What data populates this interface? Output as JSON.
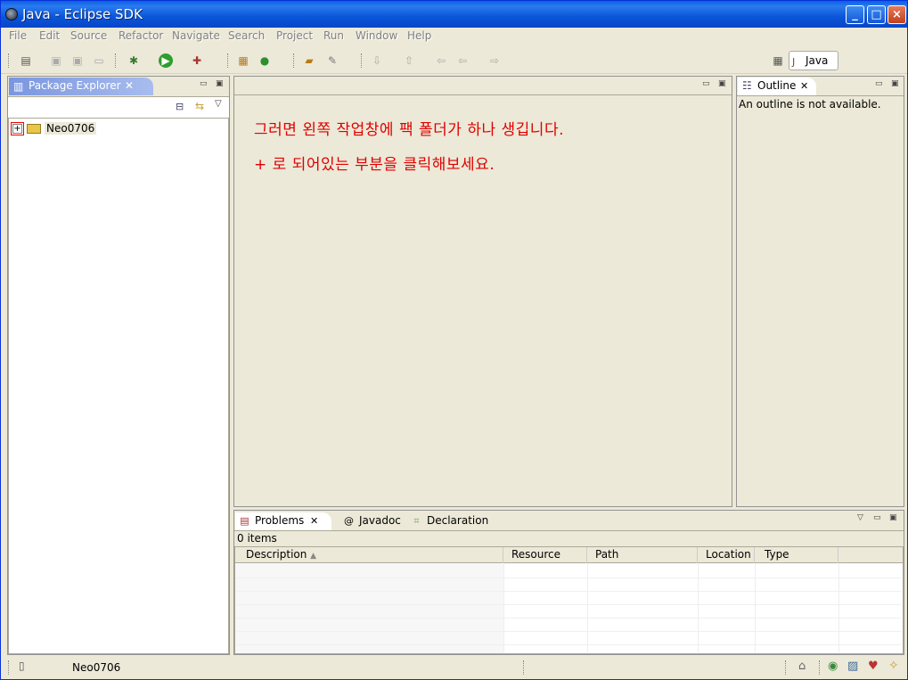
{
  "window": {
    "title": "Java - Eclipse SDK",
    "minimize": "_",
    "maximize": "□",
    "close": "×"
  },
  "menu": [
    "File",
    "Edit",
    "Source",
    "Refactor",
    "Navigate",
    "Search",
    "Project",
    "Run",
    "Window",
    "Help"
  ],
  "perspective": {
    "label": "Java"
  },
  "package_explorer": {
    "tab_label": "Package Explorer",
    "tree": [
      {
        "label": "Neo0706",
        "expander": "+"
      }
    ]
  },
  "editor": {
    "line1": "그러면 왼쪽 작업창에 팩 폴더가 하나 생깁니다.",
    "line2": "+ 로 되어있는 부분을 클릭해보세요."
  },
  "outline": {
    "tab_label": "Outline",
    "message": "An outline is not available."
  },
  "bottom_panel": {
    "tabs": [
      {
        "label": "Problems",
        "icon": "problems-icon"
      },
      {
        "label": "Javadoc",
        "icon": "@"
      },
      {
        "label": "Declaration",
        "icon": "declaration-icon"
      }
    ],
    "count": "0 items",
    "columns": [
      "Description",
      "Resource",
      "Path",
      "Location",
      "Type"
    ]
  },
  "status": {
    "selected": "Neo0706"
  },
  "colors": {
    "accent": "#0a55d8",
    "annotation": "#e00000"
  }
}
